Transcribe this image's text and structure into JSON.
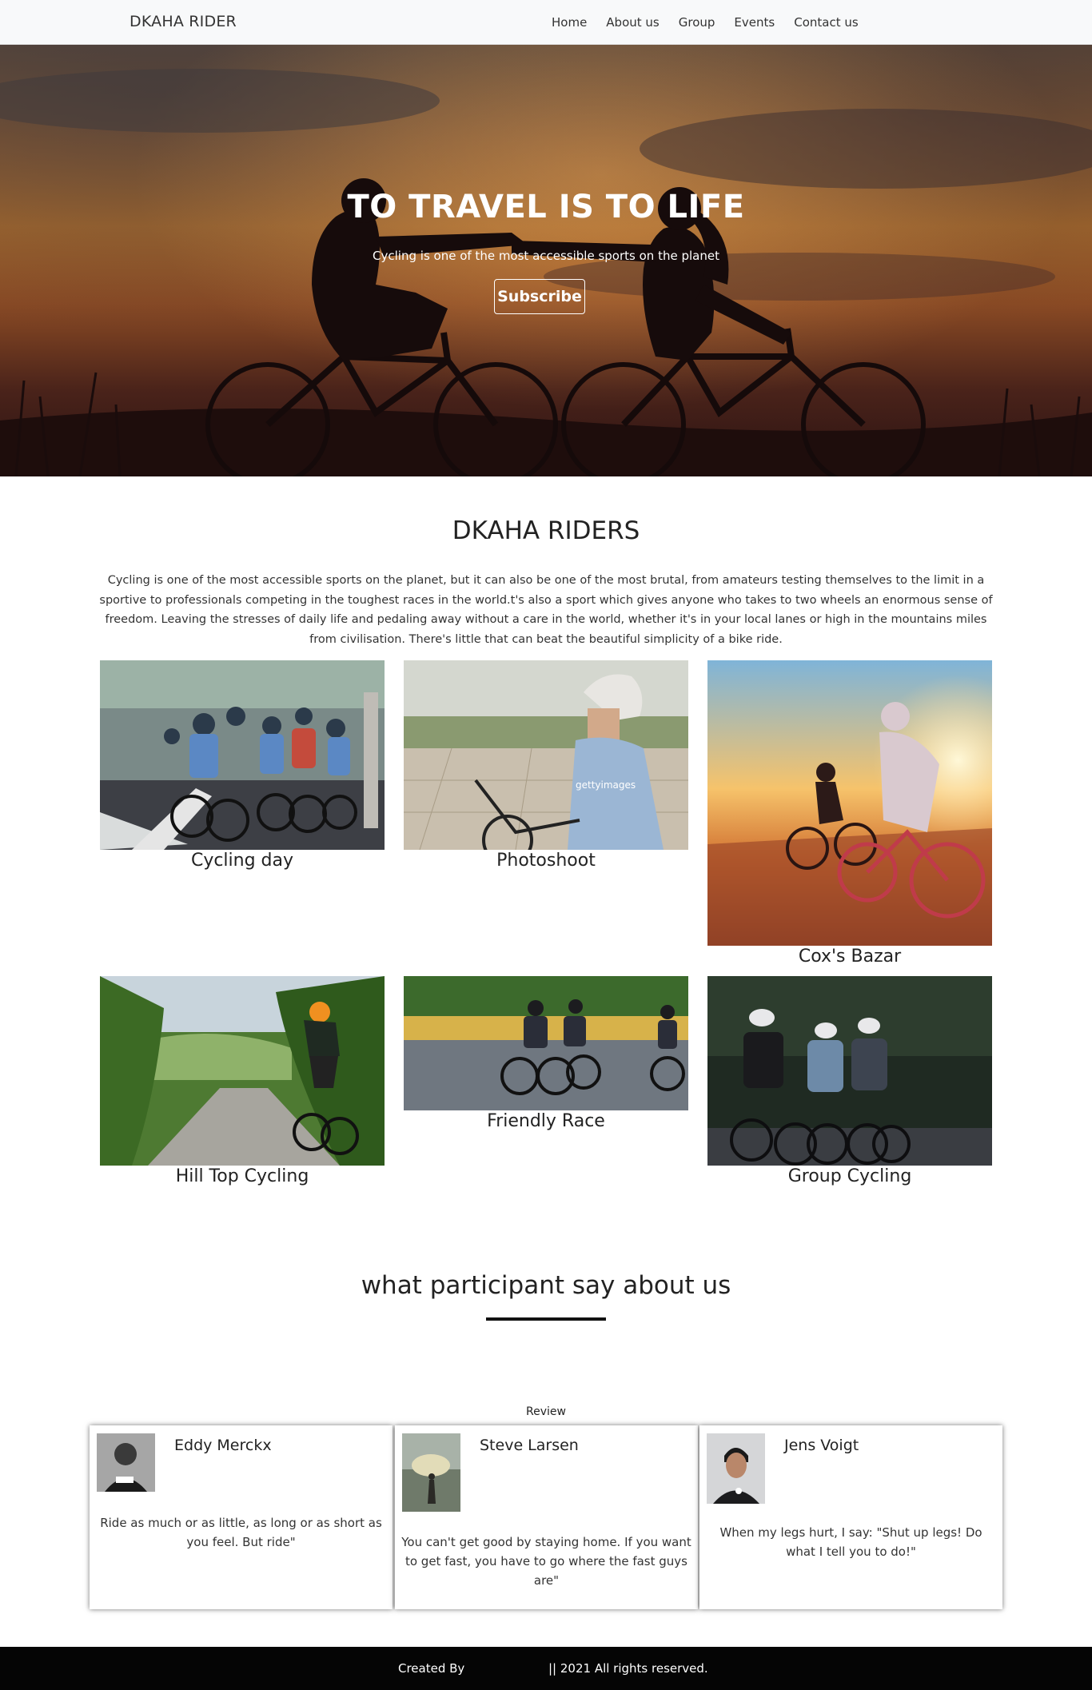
{
  "navbar": {
    "brand": "DKAHA RIDER",
    "links": [
      "Home",
      "About us",
      "Group",
      "Events",
      "Contact us"
    ]
  },
  "hero": {
    "title": "TO TRAVEL IS TO LIFE",
    "subtitle": "Cycling is one of the most accessible sports on the planet",
    "button": "Subscribe"
  },
  "about": {
    "title": "DKAHA RIDERS",
    "text": "Cycling is one of the most accessible sports on the planet, but it can also be one of the most brutal, from amateurs testing themselves to the limit in a sportive to professionals competing in the toughest races in the world.t's also a sport which gives anyone who takes to two wheels an enormous sense of freedom. Leaving the stresses of daily life and pedaling away without a care in the world, whether it's in your local lanes or high in the mountains miles from civilisation. There's little that can beat the beautiful simplicity of a bike ride."
  },
  "gallery": [
    {
      "caption": "Cycling day"
    },
    {
      "caption": "Photoshoot",
      "watermark": "gettyimages"
    },
    {
      "caption": "Cox's Bazar"
    },
    {
      "caption": "Hill Top Cycling"
    },
    {
      "caption": "Friendly Race"
    },
    {
      "caption": "Group Cycling"
    }
  ],
  "testimonials": {
    "title": "what participant say about us",
    "label": "Review",
    "reviews": [
      {
        "name": "Eddy Merckx",
        "quote": "Ride as much or as little, as long or as short as you feel. But ride\""
      },
      {
        "name": "Steve Larsen",
        "quote": "You can't get good by staying home. If you want to get fast, you have to go where the fast guys are\""
      },
      {
        "name": "Jens Voigt",
        "quote": "When my legs hurt, I say: \"Shut up legs! Do what I tell you to do!\""
      }
    ]
  },
  "footer": {
    "created": "Created By",
    "rights": "|| 2021 All rights reserved."
  },
  "colors": {
    "navbar_bg": "#f8f9fa",
    "footer_bg": "#050505",
    "hero_sunset": "#a96a2c"
  }
}
